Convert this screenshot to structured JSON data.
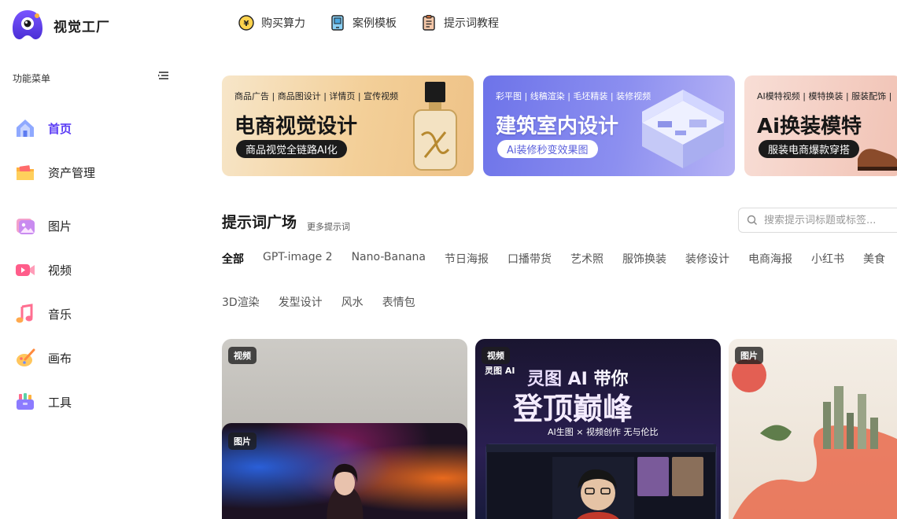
{
  "app": {
    "name": "视觉工厂",
    "accent": "#5b3cf5"
  },
  "topnav": [
    {
      "label": "购买算力",
      "icon": "coin-icon"
    },
    {
      "label": "案例模板",
      "icon": "template-phone-icon"
    },
    {
      "label": "提示词教程",
      "icon": "clipboard-icon"
    }
  ],
  "sidebar": {
    "title": "功能菜单",
    "items": [
      {
        "label": "首页",
        "icon": "home-icon",
        "active": true
      },
      {
        "label": "资产管理",
        "icon": "folder-icon"
      },
      {
        "label": "图片",
        "icon": "image-icon"
      },
      {
        "label": "视频",
        "icon": "video-icon"
      },
      {
        "label": "音乐",
        "icon": "music-icon"
      },
      {
        "label": "画布",
        "icon": "canvas-icon"
      },
      {
        "label": "工具",
        "icon": "toolbox-icon"
      }
    ]
  },
  "banners": [
    {
      "tags": "商品广告 | 商品图设计 | 详情页 | 宣传视频",
      "headline": "电商视觉设计",
      "pill": "商品视觉全链路AI化"
    },
    {
      "tags": "彩平图 | 线稿渲染 | 毛坯精装 | 装修视频",
      "headline": "建筑室内设计",
      "pill": "Ai装修秒变效果图"
    },
    {
      "tags": "AI模特视频 | 模特换装 | 服装配饰 |",
      "headline": "Ai换装模特",
      "pill": "服装电商爆款穿搭"
    }
  ],
  "prompts": {
    "title": "提示词广场",
    "more": "更多提示词",
    "search_placeholder": "搜索提示词标题或标签...",
    "categories_row1": [
      "全部",
      "GPT-image 2",
      "Nano-Banana",
      "节日海报",
      "口播带货",
      "艺术照",
      "服饰换装",
      "装修设计",
      "电商海报",
      "小红书",
      "美食"
    ],
    "categories_row2": [
      "3D渲染",
      "发型设计",
      "风水",
      "表情包"
    ]
  },
  "cards": [
    {
      "badge": "视频"
    },
    {
      "badge": "图片"
    },
    {
      "badge": "视频",
      "text_line1": "灵图 AI 带你",
      "text_line2": "登顶巅峰",
      "text_line3": "AI生图 × 视频创作   无与伦比",
      "brand": "灵图 AI"
    },
    {
      "badge": "图片"
    }
  ]
}
